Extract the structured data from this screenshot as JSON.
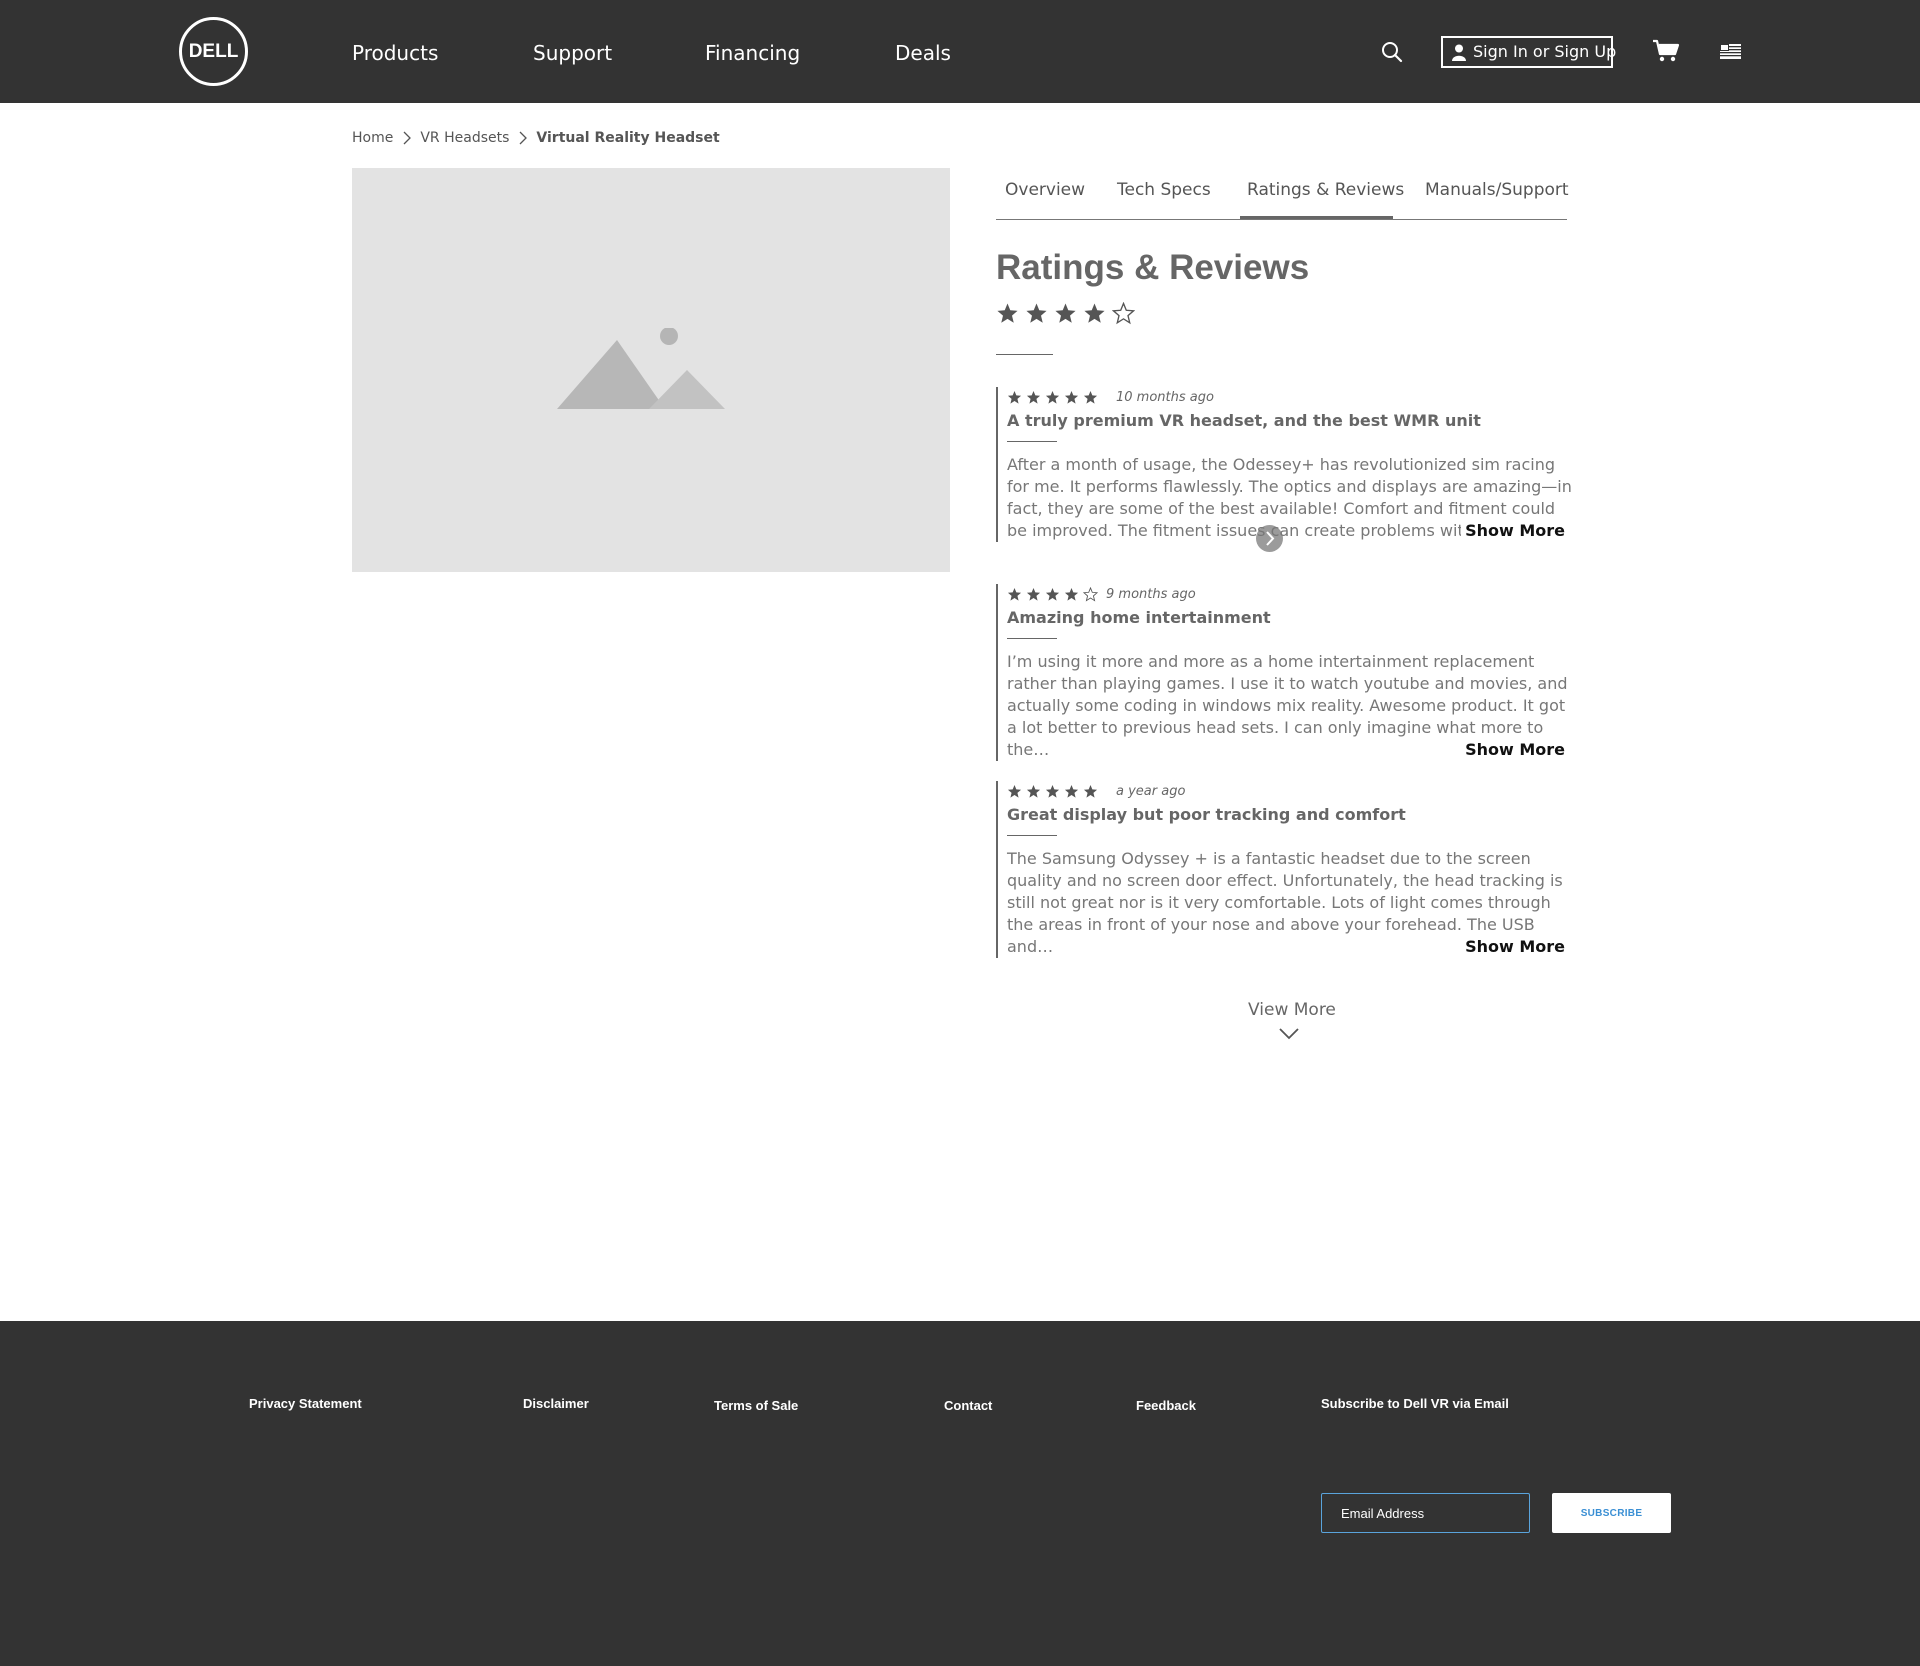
{
  "header": {
    "logo_text": "DELL",
    "nav": [
      "Products",
      "Support",
      "Financing",
      "Deals"
    ],
    "signin_label": "Sign In or Sign Up",
    "icons": [
      "search-icon",
      "user-icon",
      "cart-icon",
      "us-flag-icon"
    ]
  },
  "breadcrumb": [
    "Home",
    "VR Headsets",
    "Virtual Reality Headset"
  ],
  "tabs": {
    "items": [
      "Overview",
      "Tech Specs",
      "Ratings & Reviews",
      "Manuals/Support"
    ],
    "active": "Ratings & Reviews"
  },
  "ratings": {
    "title": "Ratings & Reviews",
    "average_stars": 4,
    "max_stars": 5,
    "reviews": [
      {
        "stars": 5,
        "date": "10 months ago",
        "title": "A truly premium VR headset, and the best WMR unit",
        "body": "After a month of usage, the Odessey+ has revolutionized sim racing for me. It performs flawlessly. The optics and displays are amazing—in fact, they are some of the best available! Comfort and fitment could be improved. The fitment issues can create problems with the…",
        "show_more": "Show More"
      },
      {
        "stars": 4,
        "date": "9 months ago",
        "title": "Amazing home intertainment",
        "body": "I’m using it more and more as a home intertainment replacement rather than playing games. I use it to watch youtube and movies, and actually some coding in windows mix reality. Awesome product. It got a lot better to previous head sets. I can only imagine what more to the…",
        "show_more": "Show More"
      },
      {
        "stars": 5,
        "date": "a year ago",
        "title": "Great display but poor tracking and comfort",
        "body": "The Samsung Odyssey + is a fantastic headset due to the screen quality and no screen door effect. Unfortunately, the head tracking is still not great nor is it very comfortable. Lots of light comes through the areas in front of your nose and above your forehead. The USB and…",
        "show_more": "Show More"
      }
    ],
    "view_more": "View More"
  },
  "footer": {
    "links": [
      "Privacy Statement",
      "Disclaimer",
      "Terms of Sale",
      "Contact",
      "Feedback"
    ],
    "subscribe_title": "Subscribe to Dell VR via Email",
    "email_placeholder": "Email Address",
    "subscribe_button": "SUBSCRIBE"
  },
  "colors": {
    "header_bg": "#333333",
    "footer_bg": "#333333",
    "image_placeholder": "#e3e3e3",
    "subscribe_accent": "#3a8fd4"
  }
}
